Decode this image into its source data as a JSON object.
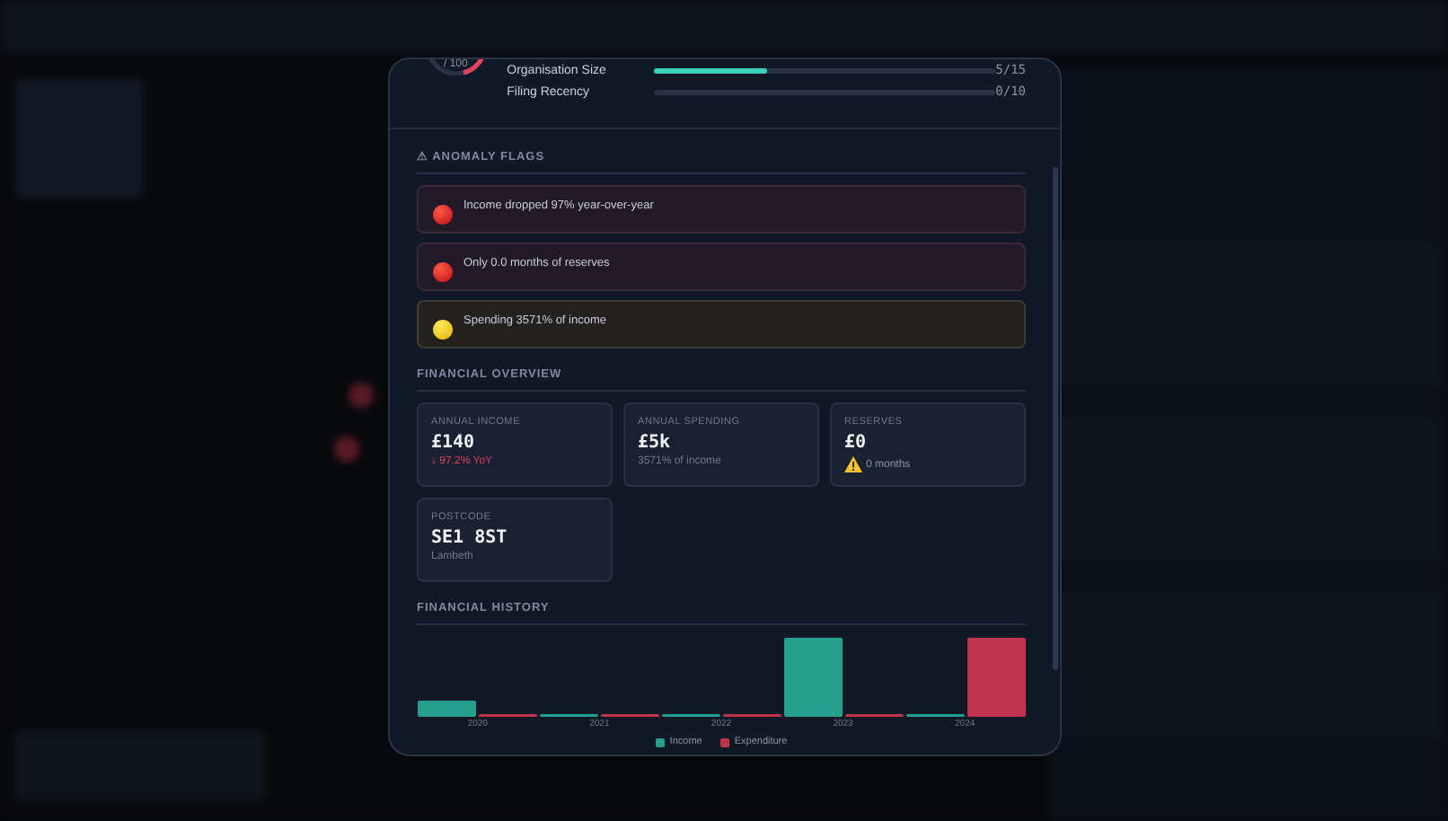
{
  "score": {
    "suffix": "/ 100",
    "factors": [
      {
        "label": "Organisation Size",
        "level": 0.333,
        "reading": "5/15"
      },
      {
        "label": "Filing Recency",
        "level": 0,
        "reading": "0/10"
      }
    ]
  },
  "anomaly_flags": {
    "title": "⚠ ANOMALY FLAGS",
    "items": [
      {
        "kind": "high",
        "text": "Income dropped 97% year-over-year"
      },
      {
        "kind": "high",
        "text": "Only 0.0 months of reserves"
      },
      {
        "kind": "medium",
        "text": "Spending 3571% of income"
      }
    ]
  },
  "financial_overview": {
    "title": "FINANCIAL OVERVIEW",
    "cards": [
      {
        "label": "ANNUAL INCOME",
        "value": "£140",
        "note": "↓ 97.2% YoY",
        "kind": "negative"
      },
      {
        "label": "ANNUAL SPENDING",
        "value": "£5k",
        "note": "3571% of income",
        "kind": "plain"
      },
      {
        "label": "RESERVES",
        "value": "£0",
        "note": "0 months",
        "kind": "warning"
      },
      {
        "label": "POSTCODE",
        "value": "SE1 8ST",
        "note": "Lambeth",
        "kind": "plain"
      }
    ]
  },
  "financial_history": {
    "title": "FINANCIAL HISTORY",
    "categories": [
      "2020",
      "2021",
      "2022",
      "2023",
      "2024"
    ],
    "legend": [
      {
        "name": "Income",
        "color": "#26a08e"
      },
      {
        "name": "Expenditure",
        "color": "#c0344e"
      }
    ]
  }
}
